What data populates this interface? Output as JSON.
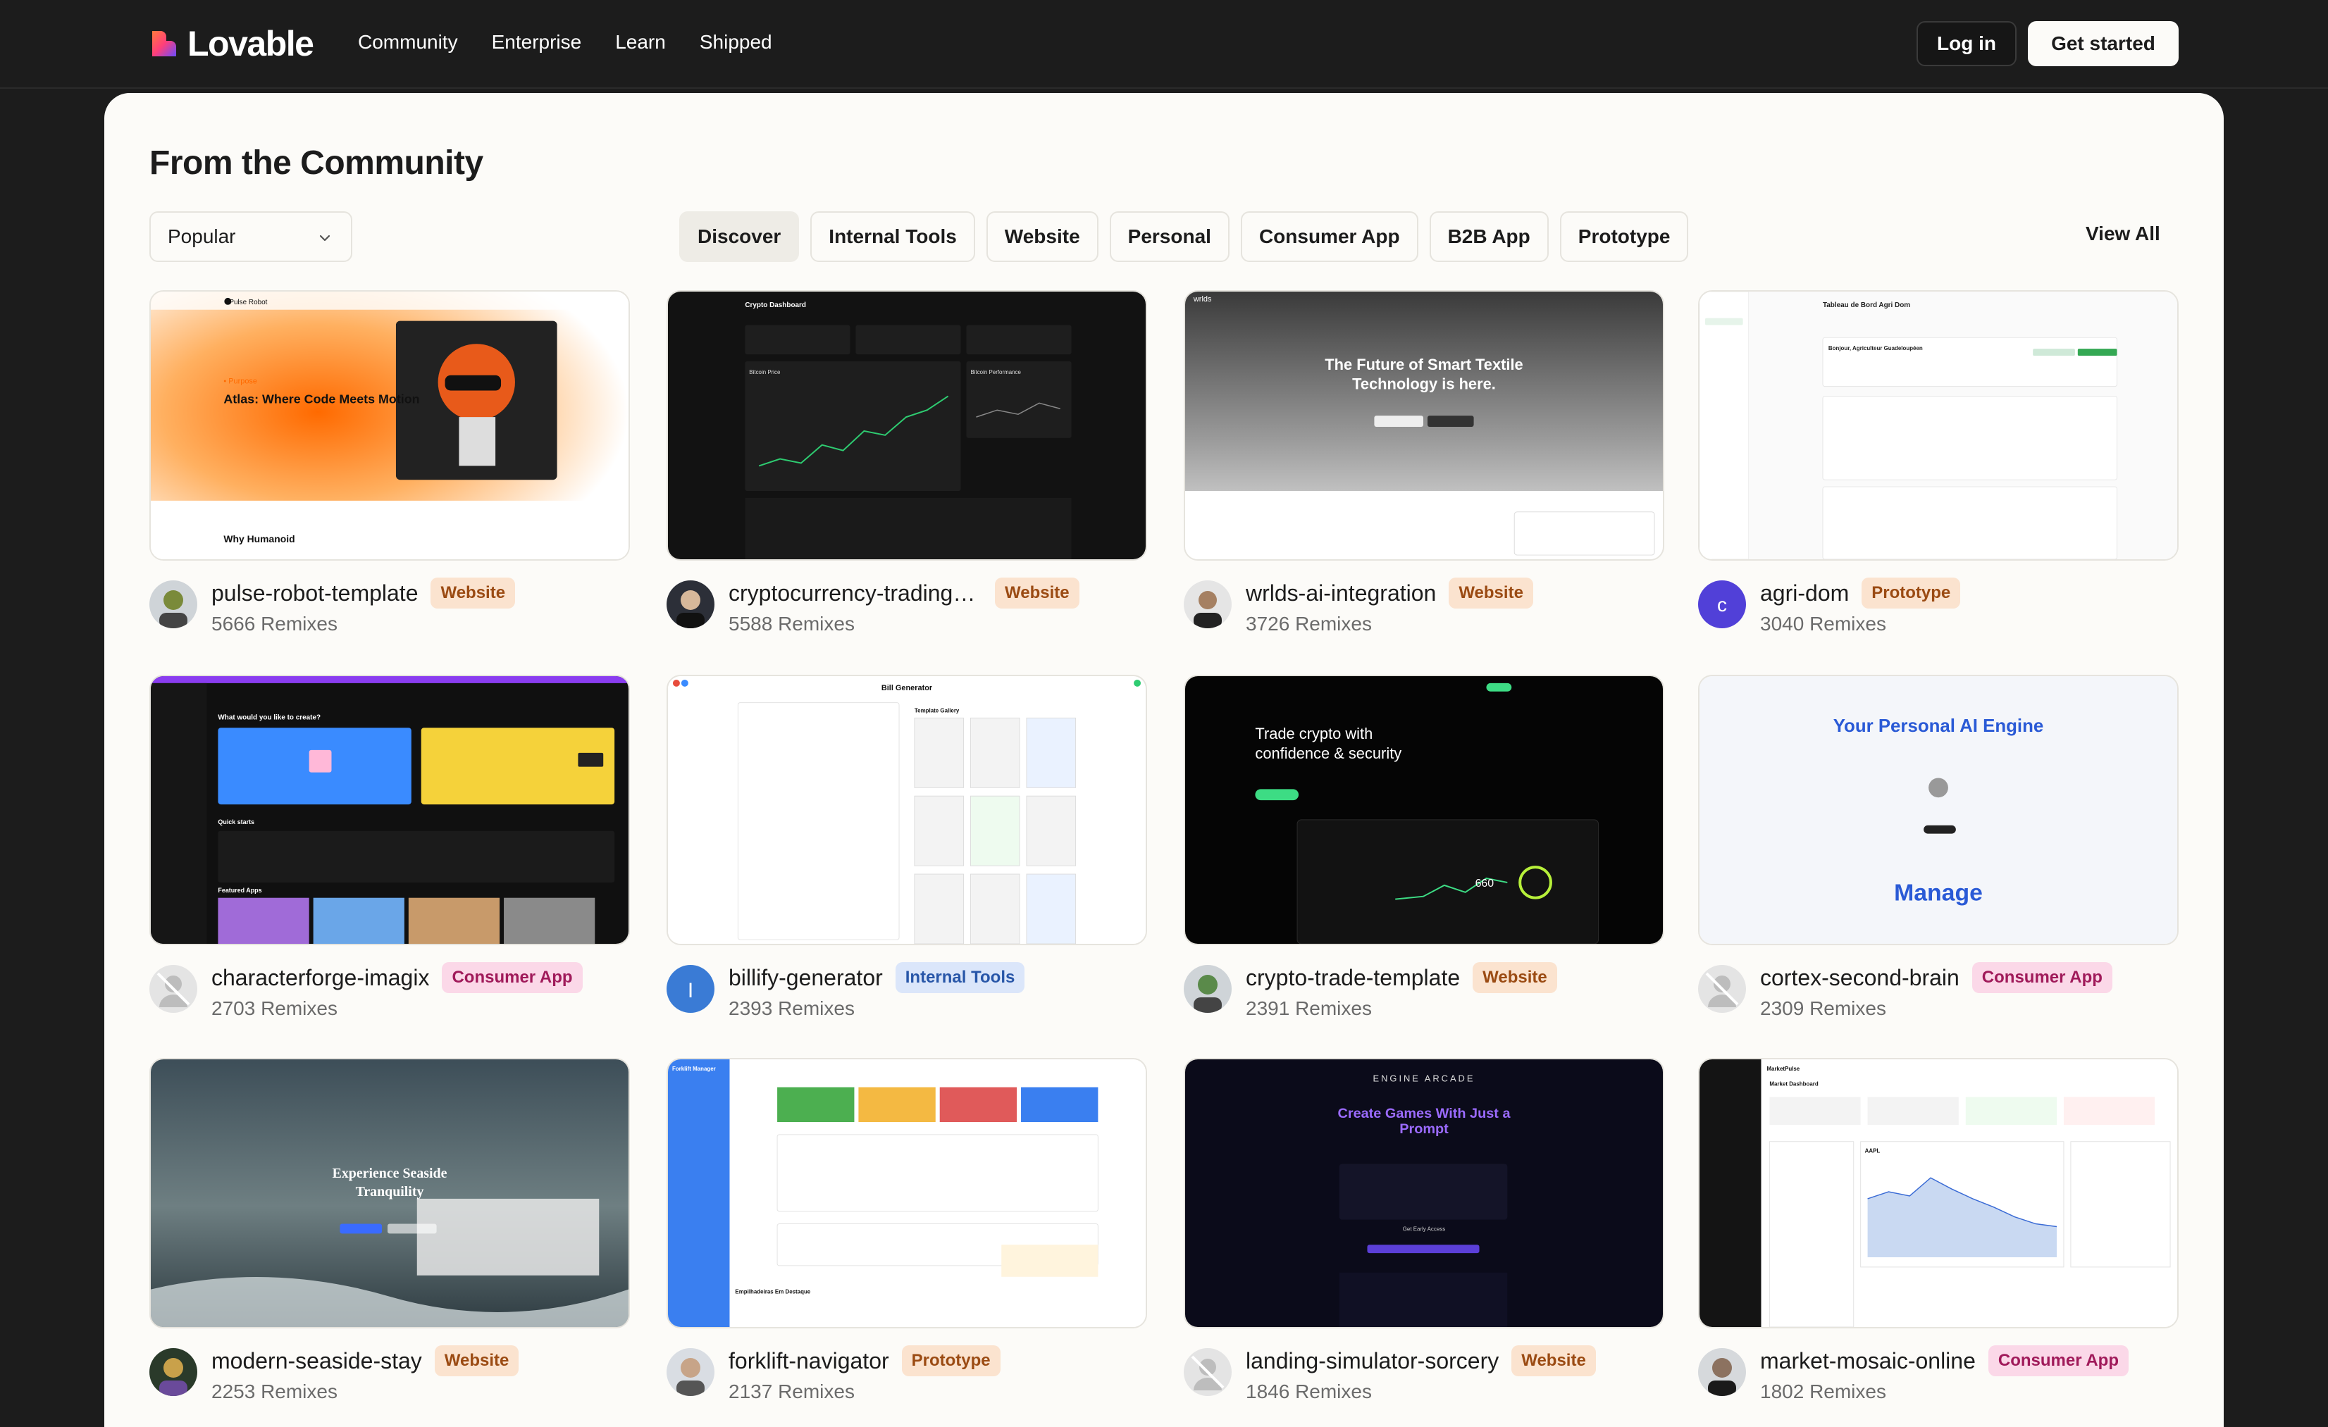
{
  "nav": {
    "logo": "Lovable",
    "links": [
      "Community",
      "Enterprise",
      "Learn",
      "Shipped"
    ],
    "login": "Log in",
    "get_started": "Get started"
  },
  "section": {
    "title": "From the Community",
    "sort": "Popular",
    "view_all": "View All",
    "categories": [
      "Discover",
      "Internal Tools",
      "Website",
      "Personal",
      "Consumer App",
      "B2B App",
      "Prototype"
    ],
    "active_category": "Discover"
  },
  "projects": [
    {
      "name": "pulse-robot-template",
      "badge": "Website",
      "remixes": "5666 Remixes",
      "thumb_title": "Atlas: Where Code Meets Motion",
      "thumb_sub": "Why Humanoid",
      "brand": "Pulse Robot"
    },
    {
      "name": "cryptocurrency-trading-dash...",
      "badge": "Website",
      "remixes": "5588 Remixes",
      "thumb_title": "Crypto Dashboard",
      "thumb_sub": "Bitcoin Price",
      "brand": "Bitcoin Performance"
    },
    {
      "name": "wrlds-ai-integration",
      "badge": "Website",
      "remixes": "3726 Remixes",
      "thumb_title": "The Future of Smart Textile Technology is here.",
      "brand": "wrlds"
    },
    {
      "name": "agri-dom",
      "badge": "Prototype",
      "remixes": "3040 Remixes",
      "thumb_title": "Tableau de Bord Agri Dom",
      "thumb_sub": "Bonjour, Agriculteur Guadeloupéen",
      "avatar_letter": "c"
    },
    {
      "name": "characterforge-imagix",
      "badge": "Consumer App",
      "remixes": "2703 Remixes",
      "thumb_title": "What would you like to create?",
      "thumb_sub": "Quick starts",
      "thumb_sub2": "Featured Apps"
    },
    {
      "name": "billify-generator",
      "badge": "Internal Tools",
      "remixes": "2393 Remixes",
      "thumb_title": "Bill Generator",
      "thumb_sub": "Template Gallery",
      "avatar_letter": "I"
    },
    {
      "name": "crypto-trade-template",
      "badge": "Website",
      "remixes": "2391 Remixes",
      "thumb_title": "Trade crypto with confidence & security",
      "thumb_sub": "660"
    },
    {
      "name": "cortex-second-brain",
      "badge": "Consumer App",
      "remixes": "2309 Remixes",
      "thumb_title": "Your Personal AI Engine",
      "thumb_sub": "Manage"
    },
    {
      "name": "modern-seaside-stay",
      "badge": "Website",
      "remixes": "2253 Remixes",
      "thumb_title": "Experience Seaside Tranquility"
    },
    {
      "name": "forklift-navigator",
      "badge": "Prototype",
      "remixes": "2137 Remixes",
      "thumb_title": "Forklift Manager",
      "thumb_sub": "Empilhadeiras Em Destaque"
    },
    {
      "name": "landing-simulator-sorcery",
      "badge": "Website",
      "remixes": "1846 Remixes",
      "thumb_title": "Create Games With Just a Prompt",
      "brand": "ENGINE ARCADE",
      "thumb_sub": "Get Early Access"
    },
    {
      "name": "market-mosaic-online",
      "badge": "Consumer App",
      "remixes": "1802 Remixes",
      "thumb_title": "Market Dashboard",
      "thumb_sub": "AAPL",
      "brand": "MarketPulse"
    }
  ],
  "colors": {
    "bg": "#1c1c1c",
    "panel": "#fcfbf8",
    "website_badge": "#fbe3cf",
    "consumer_badge": "#fbd8e8",
    "internal_badge": "#dbe6fa"
  }
}
